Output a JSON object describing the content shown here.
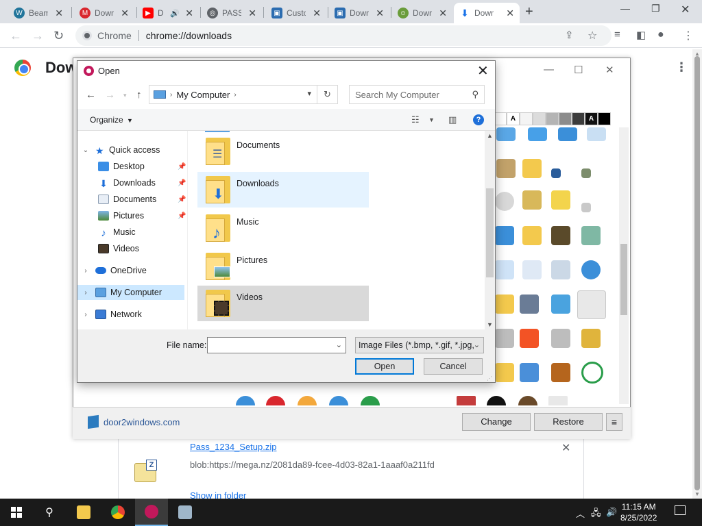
{
  "browser": {
    "tabs": [
      {
        "title": "Beam",
        "icon": "wordpress-icon"
      },
      {
        "title": "Down",
        "icon": "mega-icon"
      },
      {
        "title": "D",
        "icon": "youtube-icon"
      },
      {
        "title": "PASS",
        "icon": "globe-icon"
      },
      {
        "title": "Custo",
        "icon": "app-icon"
      },
      {
        "title": "Down",
        "icon": "app-icon"
      },
      {
        "title": "Down",
        "icon": "app-icon"
      },
      {
        "title": "Down",
        "icon": "download-icon"
      }
    ],
    "site_label": "Chrome",
    "url": "chrome://downloads"
  },
  "downloads_page": {
    "title": "Dow",
    "item": {
      "filename": "Pass_1234_Setup.zip",
      "source": "blob:https://mega.nz/2081da89-fcee-4d03-82a1-1aaaf0a211fd",
      "show_in_folder": "Show in folder"
    }
  },
  "background_app": {
    "site": "door2windows.com",
    "change_label": "Change",
    "restore_label": "Restore"
  },
  "dialog": {
    "title": "Open",
    "address_crumb": "My Computer",
    "search_placeholder": "Search My Computer",
    "organize_label": "Organize",
    "nav_items": [
      {
        "label": "Quick access"
      },
      {
        "label": "Desktop"
      },
      {
        "label": "Downloads"
      },
      {
        "label": "Documents"
      },
      {
        "label": "Pictures"
      },
      {
        "label": "Music"
      },
      {
        "label": "Videos"
      },
      {
        "label": "OneDrive"
      },
      {
        "label": "My Computer"
      },
      {
        "label": "Network"
      }
    ],
    "files": [
      {
        "name": "Documents"
      },
      {
        "name": "Downloads"
      },
      {
        "name": "Music"
      },
      {
        "name": "Pictures"
      },
      {
        "name": "Videos"
      }
    ],
    "file_name_label": "File name:",
    "file_name_value": "",
    "file_type": "Image Files (*.bmp, *.gif, *.jpg,",
    "open_label": "Open",
    "cancel_label": "Cancel"
  },
  "taskbar": {
    "time": "11:15 AM",
    "date": "8/25/2022"
  }
}
